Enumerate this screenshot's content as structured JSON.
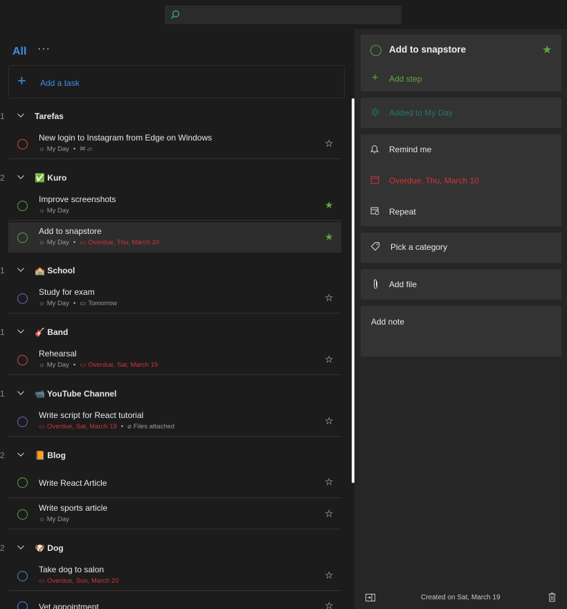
{
  "app": {
    "accent": "#3f8ee9",
    "green": "#5ea83b",
    "overdue": "#d13438"
  },
  "search": {
    "placeholder": "",
    "icon": "search-icon"
  },
  "list": {
    "title": "All",
    "more": "···",
    "add_task": "Add a task"
  },
  "groups": [
    {
      "name": "Tarefas",
      "emoji": "",
      "count": "1",
      "tasks": [
        {
          "title": "New login to Instagram from Edge on Windows",
          "my_day": "My Day",
          "color": "red",
          "starred": false
        }
      ]
    },
    {
      "name": "Kuro",
      "emoji": "✅",
      "count": "2",
      "tasks": [
        {
          "title": "Improve screenshots",
          "my_day": "My Day",
          "color": "green",
          "starred": true
        },
        {
          "title": "Add to snapstore",
          "my_day": "My Day",
          "due": "Overdue, Thu, March 10",
          "color": "green",
          "starred": true,
          "selected": true
        }
      ]
    },
    {
      "name": "School",
      "emoji": "🏫",
      "count": "1",
      "tasks": [
        {
          "title": "Study for exam",
          "my_day": "My Day",
          "due": "Tomorrow",
          "color": "purple",
          "starred": false
        }
      ]
    },
    {
      "name": "Band",
      "emoji": "🎸",
      "count": "1",
      "tasks": [
        {
          "title": "Rehearsal",
          "my_day": "My Day",
          "due": "Overdue, Sat, March 19",
          "color": "red",
          "starred": false
        }
      ]
    },
    {
      "name": "YouTube Channel",
      "emoji": "📹",
      "count": "1",
      "tasks": [
        {
          "title": "Write script for React tutorial",
          "due": "Overdue, Sat, March 19",
          "files": "Files attached",
          "color": "purple",
          "starred": false
        }
      ]
    },
    {
      "name": "Blog",
      "emoji": "📙",
      "count": "2",
      "tasks": [
        {
          "title": "Write React Article",
          "color": "green",
          "starred": false
        },
        {
          "title": "Write sports article",
          "my_day": "My Day",
          "color": "green",
          "starred": false
        }
      ]
    },
    {
      "name": "Dog",
      "emoji": "🐶",
      "count": "2",
      "tasks": [
        {
          "title": "Take dog to salon",
          "due": "Overdue, Sun, March 20",
          "color": "blue",
          "starred": false
        },
        {
          "title": "Vet appointment",
          "color": "blue",
          "starred": false
        }
      ]
    }
  ],
  "detail": {
    "title": "Add to snapstore",
    "add_step": "Add step",
    "added_to_my_day": "Added to My Day",
    "remind_me": "Remind me",
    "due": "Overdue, Thu, March 10",
    "repeat": "Repeat",
    "category": "Pick a category",
    "add_file": "Add file",
    "add_note": "Add note",
    "created": "Created on Sat, March 19"
  }
}
